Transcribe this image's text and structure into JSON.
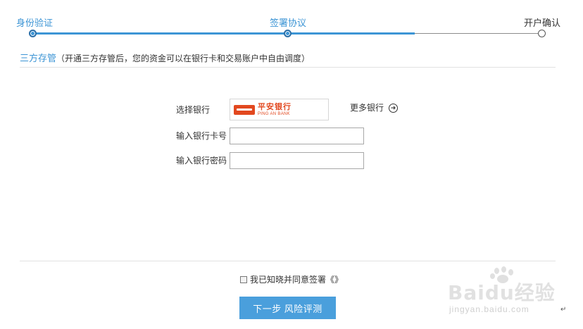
{
  "steps": [
    {
      "label": "身份验证",
      "state": "done"
    },
    {
      "label": "签署协议",
      "state": "current"
    },
    {
      "label": "开户确认",
      "state": "todo"
    }
  ],
  "section": {
    "title": "三方存管",
    "note": "（开通三方存管后，您的资金可以在银行卡和交易账户中自由调度）"
  },
  "form": {
    "bank_label": "选择银行",
    "bank_name_cn": "平安银行",
    "bank_name_en": "PING AN BANK",
    "more_banks": "更多银行",
    "card_label": "输入银行卡号",
    "card_value": "",
    "password_label": "输入银行密码",
    "password_value": ""
  },
  "agreement": {
    "text": "我已知晓并同意签署",
    "link": "《》",
    "checked": false
  },
  "next_button": "下一步 风险评测",
  "watermark": {
    "brand": "Baidu经验",
    "url": "jingyan.baidu.com"
  },
  "colors": {
    "accent": "#3d95d5",
    "button": "#4a9fdc",
    "bank_brand": "#e2481f"
  }
}
